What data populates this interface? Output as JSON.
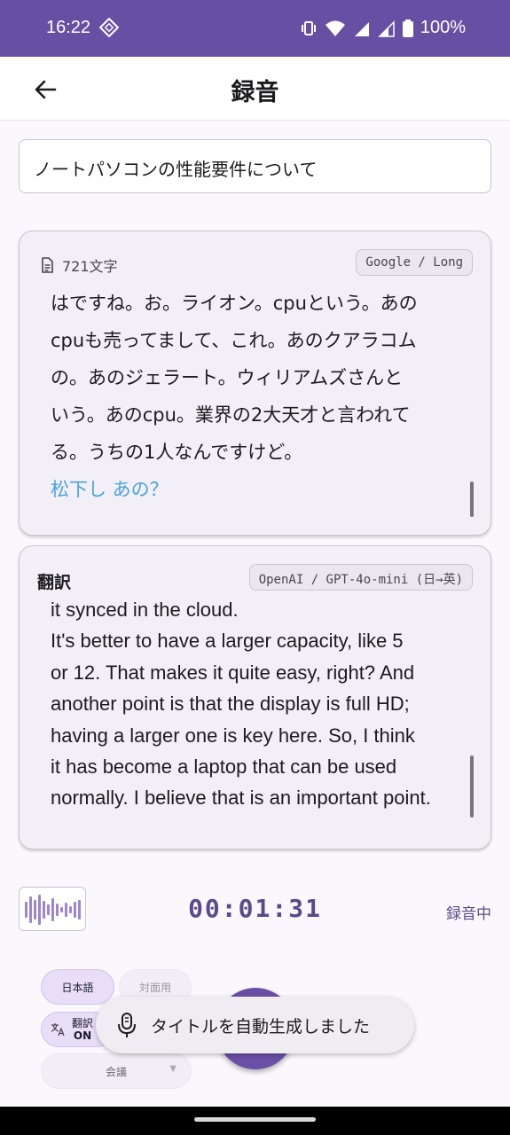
{
  "status_bar": {
    "time": "16:22",
    "battery": "100%"
  },
  "app_bar": {
    "title": "録音"
  },
  "title_field": {
    "value": "ノートパソコンの性能要件について"
  },
  "transcript": {
    "char_count": "721文字",
    "engine_badge": "Google / Long",
    "lines": [
      "はですね。お。ライオン。cpuという。あの",
      "cpuも売ってまして、これ。あのクアラコム",
      "の。あのジェラート。ウィリアムズさんと",
      "いう。あのcpu。業界の2大天才と言われて",
      "る。うちの1人なんですけど。"
    ],
    "partial_text": "松下し あの？"
  },
  "translation": {
    "label": "翻訳",
    "engine_badge": "OpenAI / GPT-4o-mini (日→英)",
    "lines": [
      "it synced in the cloud.",
      "It's better to have a larger capacity, like 5",
      "or 12. That makes it quite easy, right? And",
      "another point is that the display is full HD;",
      "having a larger one is key here. So, I think",
      "it has become a laptop that can be used",
      "normally. I believe that is an important point."
    ]
  },
  "recorder": {
    "timer": "00:01:31",
    "status": "録音中"
  },
  "controls": {
    "language_chip": "日本語",
    "face_chip": "対面用",
    "translate_chip_line1": "翻訳",
    "translate_chip_line2": "ON",
    "mode_select": "会議"
  },
  "toast": {
    "message": "タイトルを自動生成しました"
  },
  "colors": {
    "primary": "#6750a4",
    "timer": "#5b4a8b",
    "partial": "#4aa3df"
  }
}
